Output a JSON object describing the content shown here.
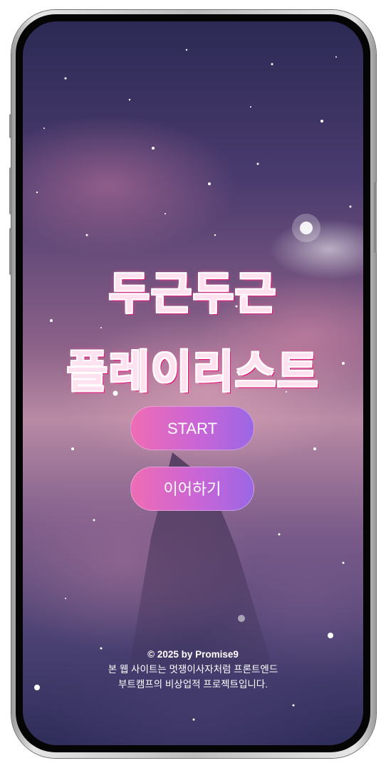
{
  "app": {
    "title_line1": "두근두근",
    "title_line2": "플레이리스트"
  },
  "buttons": {
    "start_label": "START",
    "continue_label": "이어하기"
  },
  "footer": {
    "copyright": "© 2025 by Promise9",
    "line1": "본 웹 사이트는 멋쟁이사자처럼 프론트엔드",
    "line2": "부트캠프의 비상업적 프로젝트입니다."
  },
  "colors": {
    "button_gradient_start": "#ef6cb4",
    "button_gradient_end": "#9b67e4",
    "title_fill": "#ffe2f0",
    "title_glow": "#e3006f"
  }
}
